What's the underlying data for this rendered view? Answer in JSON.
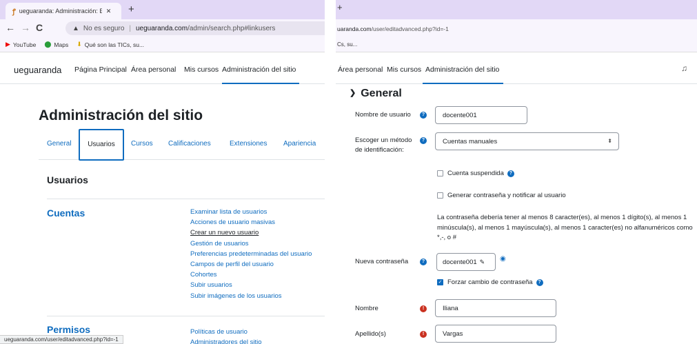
{
  "left": {
    "tab_title": "ueguaranda: Administración: Bus",
    "tab_favicon": "moodle-hat-icon",
    "url_warning": "No es seguro",
    "url_host": "ueguaranda.com",
    "url_path": "/admin/search.php#linkusers",
    "bookmarks": [
      "YouTube",
      "Maps",
      "Qué son las TICs, su..."
    ],
    "brand": "ueguaranda",
    "nav": [
      "Página Principal",
      "Área personal",
      "Mis cursos",
      "Administración del sitio"
    ],
    "page_title": "Administración del sitio",
    "subtabs": [
      "General",
      "Usuarios",
      "Cursos",
      "Calificaciones",
      "Extensiones",
      "Apariencia"
    ],
    "section_heading": "Usuarios",
    "group_accounts": "Cuentas",
    "account_links": [
      "Examinar lista de usuarios",
      "Acciones de usuario masivas",
      "Crear un nuevo usuario",
      "Gestión de usuarios",
      "Preferencias predeterminadas del usuario",
      "Campos de perfil del usuario",
      "Cohortes",
      "Subir usuarios",
      "Subir imágenes de los usuarios"
    ],
    "group_permissions": "Permisos",
    "permission_links": [
      "Políticas de usuario",
      "Administradores del sitio"
    ],
    "status_url": "ueguaranda.com/user/editadvanced.php?id=-1"
  },
  "right": {
    "url_host": "uaranda.com",
    "url_path": "/user/editadvanced.php?id=-1",
    "bookmark_fragment": "Cs, su...",
    "nav": [
      "Área personal",
      "Mis cursos",
      "Administración del sitio"
    ],
    "section": "General",
    "username_label": "Nombre de usuario",
    "username_value": "docente001",
    "auth_label_1": "Escoger un método",
    "auth_label_2": "de identificación:",
    "auth_value": "Cuentas manuales",
    "suspended_label": "Cuenta suspendida",
    "generate_pw_label": "Generar contraseña y notificar al usuario",
    "pw_policy": "La contraseña debería tener al menos 8 caracter(es), al menos 1 dígito(s), al menos 1 minúscula(s), al menos 1 mayúscula(s), al menos 1 caracter(es) no alfanuméricos como *,-, o #",
    "new_pw_label": "Nueva contraseña",
    "new_pw_value": "docente001",
    "force_change_label": "Forzar cambio de contraseña",
    "firstname_label": "Nombre",
    "firstname_value": "Iliana",
    "lastname_label": "Apellido(s)",
    "lastname_value": "Vargas"
  },
  "colors": {
    "accent": "#0f6cbf",
    "required": "#ca3120",
    "chrome": "#e2d8f6"
  }
}
